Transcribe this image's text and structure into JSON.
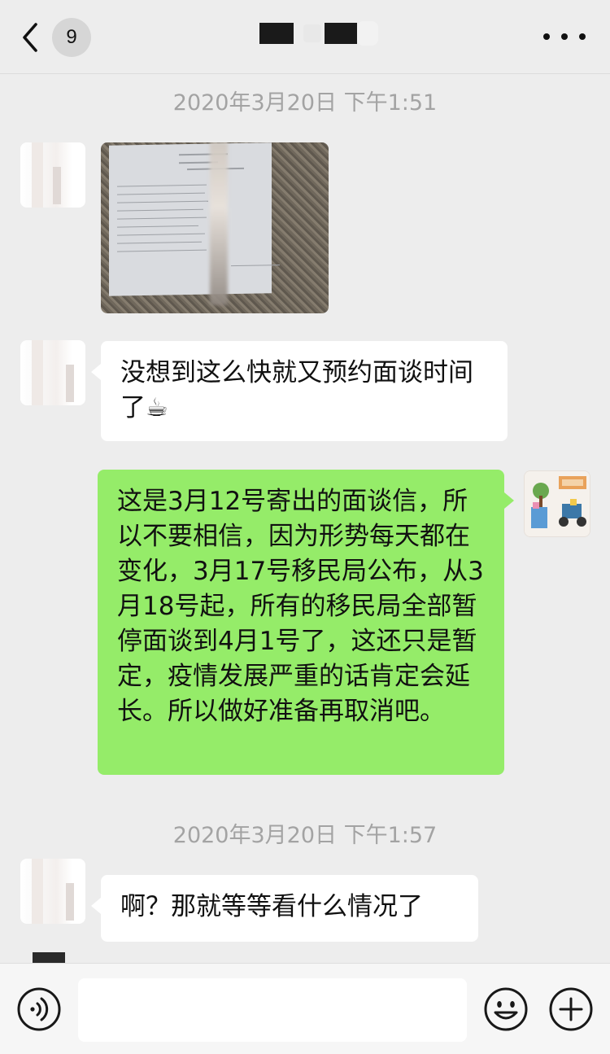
{
  "header": {
    "back_count": "9",
    "back_icon": "chevron-left-icon",
    "more_icon": "more-dots-icon"
  },
  "timestamps": [
    "2020年3月20日 下午1:51",
    "2020年3月20日 下午1:57"
  ],
  "messages": [
    {
      "from": "other",
      "type": "image"
    },
    {
      "from": "other",
      "type": "text",
      "text": "没想到这么快就又预约面谈时间了☕"
    },
    {
      "from": "me",
      "type": "text",
      "text": "这是3月12号寄出的面谈信，所以不要相信，因为形势每天都在变化，3月17号移民局公布，从3月18号起，所有的移民局全部暂停面谈到4月1号了，这还只是暂定，疫情发展严重的话肯定会延长。所以做好准备再取消吧。"
    },
    {
      "from": "other",
      "type": "text",
      "text": "啊？那就等等看什么情况了"
    }
  ],
  "input_bar": {
    "voice_icon": "voice-icon",
    "emoji_icon": "emoji-icon",
    "plus_icon": "plus-icon",
    "input_value": ""
  },
  "colors": {
    "background": "#ededed",
    "bubble_me": "#95ec69",
    "bubble_other": "#ffffff",
    "timestamp": "#a3a3a3"
  }
}
